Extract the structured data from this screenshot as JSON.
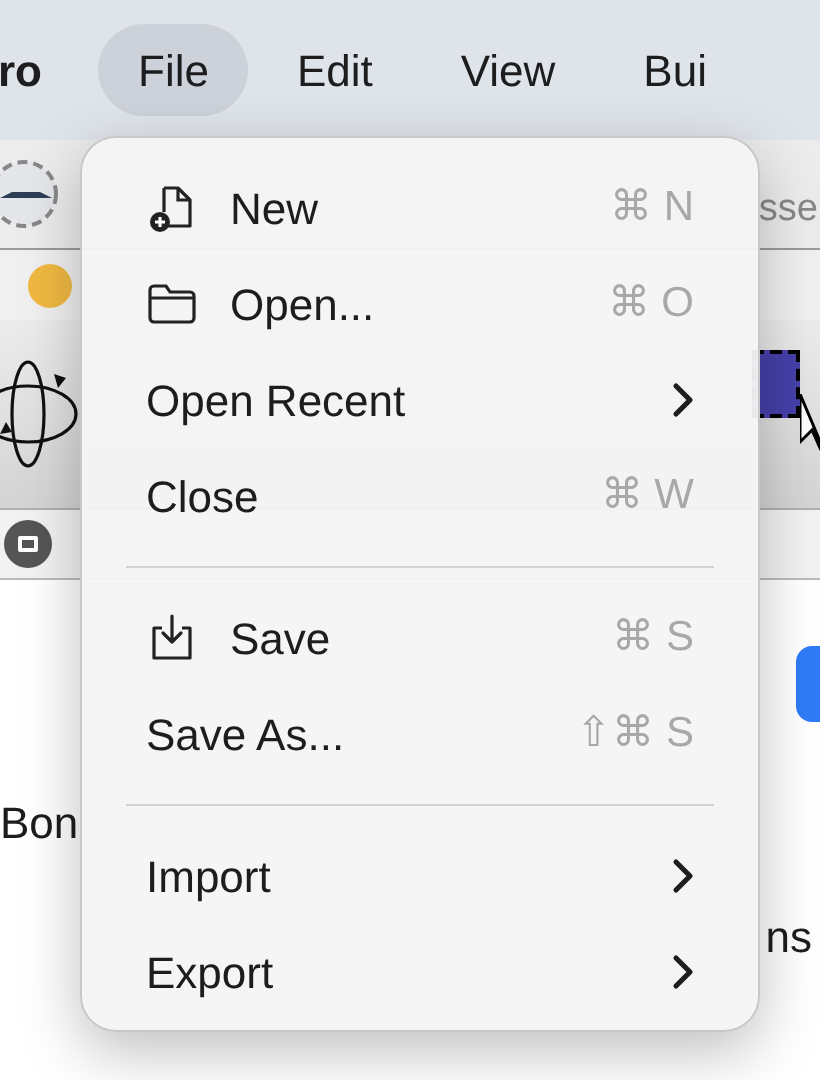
{
  "menu_bar": [
    {
      "label": "ro",
      "kind": "app",
      "selected": false
    },
    {
      "label": "File",
      "kind": "menu",
      "selected": true
    },
    {
      "label": "Edit",
      "kind": "menu",
      "selected": false
    },
    {
      "label": "View",
      "kind": "menu",
      "selected": false
    },
    {
      "label": "Bui",
      "kind": "menu",
      "selected": false
    }
  ],
  "background": {
    "tab_text": "sse",
    "left_label": "Bon",
    "right_label": "ns"
  },
  "file_menu": {
    "sections": [
      [
        {
          "label": "New",
          "shortcut": "⌘ N",
          "submenu": false
        },
        {
          "label": "Open...",
          "shortcut": "⌘ O",
          "submenu": false
        },
        {
          "label": "Open Recent",
          "submenu": true
        },
        {
          "label": "Close",
          "shortcut": "⌘ W",
          "submenu": false
        }
      ],
      [
        {
          "label": "Save",
          "shortcut": "⌘ S",
          "submenu": false
        },
        {
          "label": "Save As...",
          "shortcut": "⇧⌘ S",
          "submenu": false
        }
      ],
      [
        {
          "label": "Import",
          "submenu": true
        },
        {
          "label": "Export",
          "submenu": true
        }
      ]
    ]
  }
}
